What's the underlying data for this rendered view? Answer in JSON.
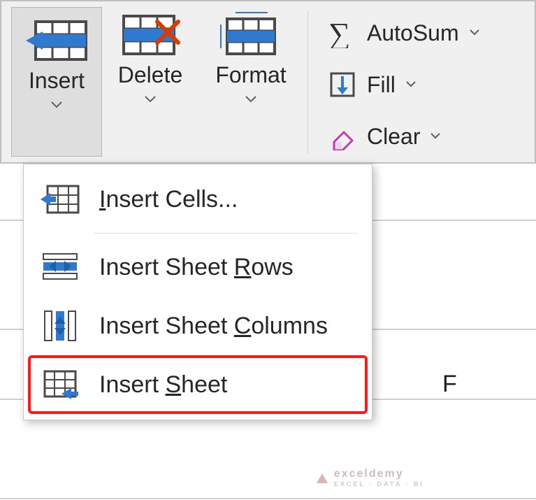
{
  "ribbon": {
    "insert_label": "Insert",
    "delete_label": "Delete",
    "format_label": "Format",
    "autosum_label": "AutoSum",
    "fill_label": "Fill",
    "clear_label": "Clear"
  },
  "menu": {
    "insert_cells": "Insert Cells...",
    "insert_sheet_rows": "Insert Sheet Rows",
    "insert_sheet_columns": "Insert Sheet Columns",
    "insert_sheet": "Insert Sheet",
    "cells_underline_letter": "I",
    "rows_underline_letter": "R",
    "cols_underline_letter": "C",
    "sheet_underline_letter": "S"
  },
  "sheet": {
    "col_letter": "F"
  },
  "watermark": {
    "brand": "exceldemy",
    "tagline": "EXCEL · DATA · BI"
  }
}
